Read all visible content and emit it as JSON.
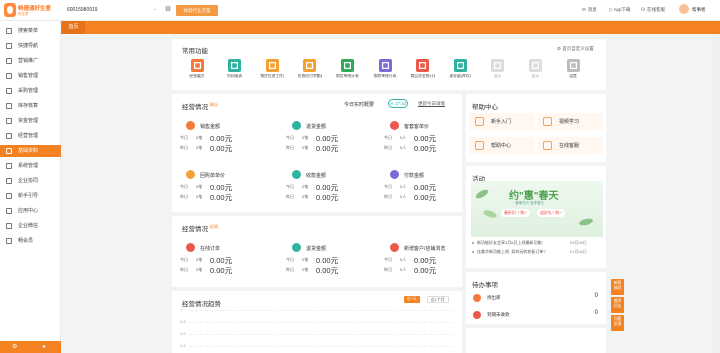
{
  "app": {
    "logo_name": "畅捷通好生意",
    "logo_sub": "好生意",
    "store_id": "60015980919",
    "switch_button": "体验行业方案",
    "topnav": [
      "消息",
      "App下载",
      "在线客服"
    ],
    "user": "帮事者"
  },
  "sidebar": {
    "items": [
      {
        "label": "搜索菜单",
        "icon": "search-icon"
      },
      {
        "label": "快捷导航",
        "icon": "compass-icon"
      },
      {
        "label": "营销推广",
        "icon": "megaphone-icon"
      },
      {
        "label": "销售管理",
        "icon": "cart-icon"
      },
      {
        "label": "采购管理",
        "icon": "truck-icon"
      },
      {
        "label": "库存核算",
        "icon": "box-icon"
      },
      {
        "label": "资金管理",
        "icon": "wallet-icon"
      },
      {
        "label": "经营管理",
        "icon": "chart-icon"
      },
      {
        "label": "基础资料",
        "icon": "folder-icon"
      },
      {
        "label": "系统管理",
        "icon": "gear-icon"
      },
      {
        "label": "企业协同",
        "icon": "team-icon"
      },
      {
        "label": "新手引导",
        "icon": "guide-icon"
      },
      {
        "label": "应用中心",
        "icon": "apps-icon"
      },
      {
        "label": "企业微信",
        "icon": "wechat-icon"
      },
      {
        "label": "畅会员",
        "icon": "member-icon"
      }
    ],
    "active_index": 8
  },
  "tabs": {
    "home": "首页"
  },
  "common_functions": {
    "title": "常用功能",
    "customize": "首页自定义设置",
    "items": [
      {
        "label": "经营魔方",
        "color": "#f57a3a"
      },
      {
        "label": "利润报表",
        "color": "#2fb3a0"
      },
      {
        "label": "销货在途工作台",
        "color": "#f5a034"
      },
      {
        "label": "应收应付余额表",
        "color": "#f5a034"
      },
      {
        "label": "销货单统计表",
        "color": "#2eaa5a"
      },
      {
        "label": "收款单统计表",
        "color": "#7c6ad6"
      },
      {
        "label": "商品资金统计表",
        "color": "#ea5a4a"
      },
      {
        "label": "现存量(库存)",
        "color": "#2fb3a0"
      },
      {
        "label": "暂无",
        "color": "#dcdcdc"
      },
      {
        "label": "暂无",
        "color": "#dcdcdc"
      },
      {
        "label": "设置",
        "color": "#bdbdbd"
      }
    ]
  },
  "business1": {
    "title": "经营情况",
    "badge": "概况",
    "realtime": "今日实时概要",
    "time": "17:33",
    "detail_link": "更新今日详情",
    "stats": [
      {
        "label": "销售金额",
        "color": "#f57a3a",
        "today_count": "0笔",
        "today_amount": "0.00元",
        "yesterday_count": "0笔",
        "yesterday_amount": "0.00元"
      },
      {
        "label": "退货金额",
        "color": "#2fb3a0",
        "today_count": "0笔",
        "today_amount": "0.00元",
        "yesterday_count": "0笔",
        "yesterday_amount": "0.00元"
      },
      {
        "label": "客套客单价",
        "color": "#ea5a4a",
        "today_count": "0人",
        "today_amount": "0.00元",
        "yesterday_count": "0人",
        "yesterday_amount": "0.00元"
      },
      {
        "label": "回购单单价",
        "color": "#f5a034",
        "today_count": "0笔",
        "today_amount": "0.00元",
        "yesterday_count": "0笔",
        "yesterday_amount": "0.00元"
      },
      {
        "label": "收款金额",
        "color": "#2fb3a0",
        "today_count": "0笔",
        "today_amount": "0.00元",
        "yesterday_count": "0笔",
        "yesterday_amount": "0.00元"
      },
      {
        "label": "付款金额",
        "color": "#7c6ad6",
        "today_count": "0人",
        "today_amount": "0.00元",
        "yesterday_count": "0人",
        "yesterday_amount": "0.00元"
      }
    ],
    "today": "今日",
    "yesterday": "昨日"
  },
  "business2": {
    "title": "经营情况",
    "badge": "促销",
    "stats": [
      {
        "label": "在线订单",
        "color": "#ea5a4a",
        "today_count": "0笔",
        "today_amount": "0.00元",
        "yesterday_count": "0笔",
        "yesterday_amount": "0.00元"
      },
      {
        "label": "退货金额",
        "color": "#2fb3a0",
        "today_count": "0笔",
        "today_amount": "0.00元",
        "yesterday_count": "0笔",
        "yesterday_amount": "0.00元"
      },
      {
        "label": "新增客户/店铺浏览",
        "color": "#ea5a4a",
        "today_count": "0人",
        "today_amount": "0.00元",
        "yesterday_count": "0人",
        "yesterday_amount": "0.00元"
      }
    ]
  },
  "trend": {
    "title": "经营情况趋势",
    "chip_active": "近7天",
    "chip_other": "近1个月",
    "yticks": [
      "1",
      "0.8",
      "0.6",
      "0.4"
    ]
  },
  "help": {
    "title": "帮助中心",
    "items": [
      "新手入门",
      "视频学习",
      "帮助中心",
      "在线客服"
    ]
  },
  "activity": {
    "title": "活动",
    "banner_title": "约\"惠\"春天",
    "banner_sub": "· 春暖花开 惠享春天 ·",
    "banner_chips": [
      "春折扣 ? 购 !",
      "送好礼? 购 !"
    ],
    "news": [
      {
        "text": "新功能好友会享3月6日上线最新功能!",
        "date": "03月06日"
      },
      {
        "text": "佳美华新功能上线, 如何玩转老板订单?",
        "date": "01月04日"
      }
    ]
  },
  "todo": {
    "title": "待办事项",
    "items": [
      {
        "label": "待出库",
        "value": "0",
        "color": "#f57a3a"
      },
      {
        "label": "到期未收款",
        "value": "0",
        "color": "#ea5a4a"
      }
    ]
  },
  "float_buttons": [
    "新版\n体验",
    "推荐\n好友",
    "问题\n反馈"
  ]
}
